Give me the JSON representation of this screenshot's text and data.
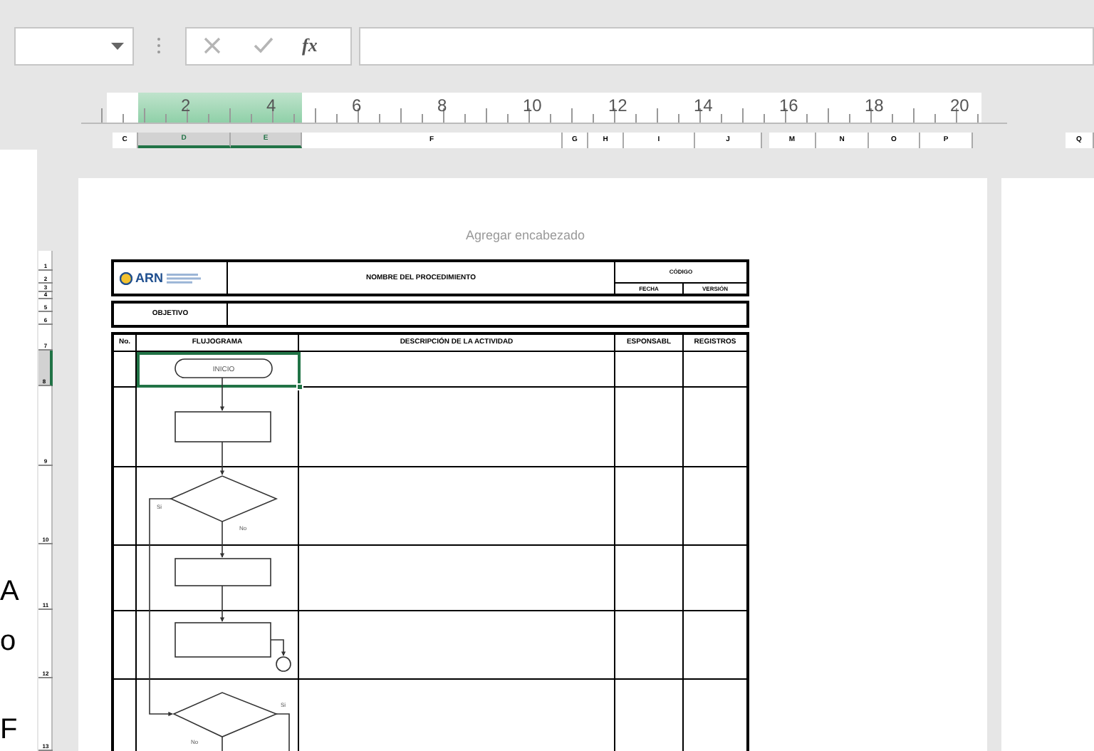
{
  "formula_bar": {
    "function_label": "fx"
  },
  "ruler": {
    "ticks": [
      "2",
      "4",
      "6",
      "8",
      "10",
      "12",
      "14",
      "16",
      "18",
      "20"
    ]
  },
  "column_headers": [
    {
      "label": "C",
      "selected": false
    },
    {
      "label": "D",
      "selected": true
    },
    {
      "label": "E",
      "selected": true
    },
    {
      "label": "F",
      "selected": false
    },
    {
      "label": "G",
      "selected": false
    },
    {
      "label": "H",
      "selected": false
    },
    {
      "label": "I",
      "selected": false
    },
    {
      "label": "J",
      "selected": false
    },
    {
      "label": "M",
      "selected": false
    },
    {
      "label": "N",
      "selected": false
    },
    {
      "label": "O",
      "selected": false
    },
    {
      "label": "P",
      "selected": false
    },
    {
      "label": "Q",
      "selected": false
    }
  ],
  "row_numbers": [
    {
      "label": "1",
      "selected": false
    },
    {
      "label": "2",
      "selected": false
    },
    {
      "label": "3",
      "selected": false
    },
    {
      "label": "4",
      "selected": false
    },
    {
      "label": "5",
      "selected": false
    },
    {
      "label": "6",
      "selected": false
    },
    {
      "label": "7",
      "selected": false
    },
    {
      "label": "8",
      "selected": true
    },
    {
      "label": "9",
      "selected": false
    },
    {
      "label": "10",
      "selected": false
    },
    {
      "label": "11",
      "selected": false
    },
    {
      "label": "12",
      "selected": false
    },
    {
      "label": "13",
      "selected": false
    }
  ],
  "previous_page_text": [
    "A",
    "o",
    "F"
  ],
  "page": {
    "header_placeholder": "Agregar encabezado"
  },
  "form": {
    "logo": "ARN",
    "title": "NOMBRE DEL PROCEDIMIENTO",
    "code_label": "CÓDIGO",
    "date_label": "FECHA",
    "version_label": "VERSIÓN",
    "objective_label": "OBJETIVO",
    "columns": [
      "No.",
      "FLUJOGRAMA",
      "DESCRIPCIÓN DE LA ACTIVIDAD",
      "ESPONSABL",
      "REGISTROS"
    ]
  },
  "flowchart": {
    "start_label": "INICIO",
    "yes_labels": [
      "Si",
      "Si"
    ],
    "no_labels": [
      "No",
      "No"
    ]
  }
}
